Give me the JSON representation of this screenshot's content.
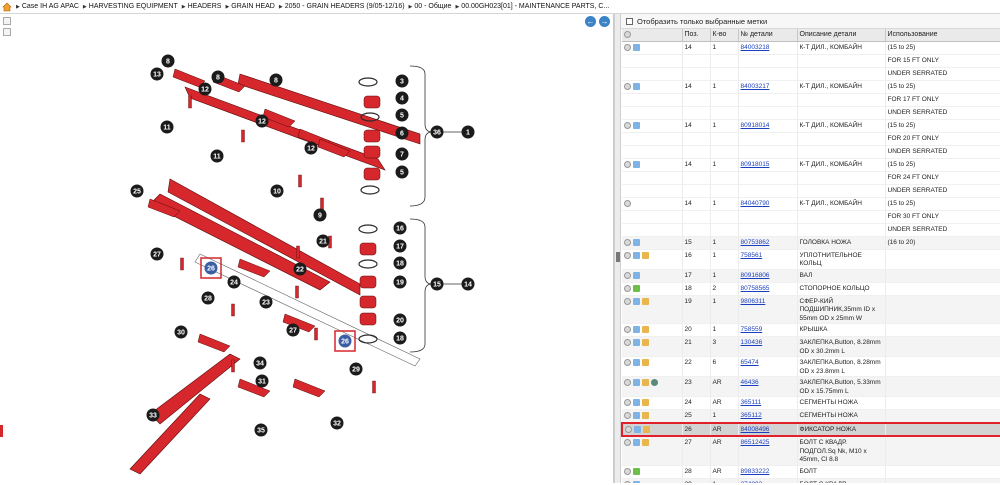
{
  "breadcrumb": [
    "Case IH AG APAC",
    "HARVESTING EQUIPMENT",
    "HEADERS",
    "GRAIN HEAD",
    "2050 - GRAIN HEADERS (9/05-12/16)",
    "00 - Общие",
    "00.00GH023[01] - MAINTENANCE PARTS, C..."
  ],
  "filter_label": "Отобразить только выбранные метки",
  "columns": [
    "Поз.",
    "К-во",
    "№ детали",
    "Описание детали",
    "Использование"
  ],
  "rows": [
    {
      "pos": "14",
      "qty": "1",
      "part": "84003218",
      "desc": "К-Т ДИЛ., КОМБАЙН",
      "use": [
        "(15 to 25)",
        "FOR 15 FT ONLY",
        "UNDER SERRATED"
      ],
      "icons": [
        "plus-icon",
        "swap-icon"
      ]
    },
    {
      "pos": "14",
      "qty": "1",
      "part": "84003217",
      "desc": "К-Т ДИЛ., КОМБАЙН",
      "use": [
        "(15 to 25)",
        "FOR 17 FT ONLY",
        "UNDER SERRATED"
      ],
      "icons": [
        "plus-icon",
        "swap-icon"
      ]
    },
    {
      "pos": "14",
      "qty": "1",
      "part": "80918014",
      "desc": "К-Т ДИЛ., КОМБАЙН",
      "use": [
        "(15 to 25)",
        "FOR 20 FT ONLY",
        "UNDER SERRATED"
      ],
      "icons": [
        "plus-icon",
        "swap-icon"
      ]
    },
    {
      "pos": "14",
      "qty": "1",
      "part": "80918015",
      "desc": "К-Т ДИЛ., КОМБАЙН",
      "use": [
        "(15 to 25)",
        "FOR 24 FT ONLY",
        "UNDER SERRATED"
      ],
      "icons": [
        "plus-icon",
        "swap-icon"
      ]
    },
    {
      "pos": "14",
      "qty": "1",
      "part": "84040790",
      "desc": "К-Т ДИЛ., КОМБАЙН",
      "use": [
        "(15 to 25)",
        "FOR 30 FT ONLY",
        "UNDER SERRATED"
      ],
      "icons": [
        "plus-icon"
      ]
    },
    {
      "pos": "15",
      "qty": "1",
      "part": "80753862",
      "desc": "ГОЛОВКА НОЖА",
      "use": [
        "(16 to 20)"
      ],
      "icons": [
        "plus-icon",
        "swap-icon"
      ]
    },
    {
      "pos": "16",
      "qty": "1",
      "part": "758561",
      "desc": "УПЛОТНИТЕЛЬНОЕ КОЛЬЦ",
      "use": [
        ""
      ],
      "icons": [
        "plus-icon",
        "swap-icon",
        "box-icon"
      ]
    },
    {
      "pos": "17",
      "qty": "1",
      "part": "80916806",
      "desc": "ВАЛ",
      "use": [
        ""
      ],
      "icons": [
        "plus-icon",
        "swap-icon"
      ]
    },
    {
      "pos": "18",
      "qty": "2",
      "part": "80758565",
      "desc": "СТОПОРНОЕ КОЛЬЦО",
      "use": [
        ""
      ],
      "icons": [
        "plus-icon",
        "arrow-icon"
      ]
    },
    {
      "pos": "19",
      "qty": "1",
      "part": "9806311",
      "desc": "СФЕР-КИЙ ПОДШИПНИК,35mm ID x 55mm OD x 25mm W",
      "use": [
        ""
      ],
      "icons": [
        "plus-icon",
        "swap-icon",
        "box-icon"
      ]
    },
    {
      "pos": "20",
      "qty": "1",
      "part": "758559",
      "desc": "КРЫШКА",
      "use": [
        ""
      ],
      "icons": [
        "plus-icon",
        "swap-icon",
        "box-icon"
      ]
    },
    {
      "pos": "21",
      "qty": "3",
      "part": "130436",
      "desc": "ЗАКЛЕПКА,Button, 8.28mm OD x 30.2mm L",
      "use": [
        ""
      ],
      "icons": [
        "plus-icon",
        "swap-icon",
        "box-icon"
      ]
    },
    {
      "pos": "22",
      "qty": "6",
      "part": "65474",
      "desc": "ЗАКЛЕПКА,Button, 8.28mm OD x 23.8mm L",
      "use": [
        ""
      ],
      "icons": [
        "plus-icon",
        "swap-icon",
        "box-icon"
      ]
    },
    {
      "pos": "23",
      "qty": "AR",
      "part": "46436",
      "desc": "ЗАКЛЕПКА,Button, 5.33mm OD x 15.75mm L",
      "use": [
        ""
      ],
      "icons": [
        "plus-icon",
        "swap-icon",
        "box-icon",
        "globe-icon"
      ]
    },
    {
      "pos": "24",
      "qty": "AR",
      "part": "365111",
      "desc": "СЕГМЕНТЫ НОЖА",
      "use": [
        ""
      ],
      "icons": [
        "plus-icon",
        "swap-icon",
        "box-icon"
      ]
    },
    {
      "pos": "25",
      "qty": "1",
      "part": "365112",
      "desc": "СЕГМЕНТЫ НОЖА",
      "use": [
        ""
      ],
      "icons": [
        "plus-icon",
        "swap-icon",
        "box-icon"
      ]
    },
    {
      "pos": "26",
      "qty": "AR",
      "part": "84008496",
      "desc": "ФИКСАТОР НОЖА",
      "use": [
        ""
      ],
      "icons": [
        "plus-icon",
        "swap-icon",
        "box-icon"
      ],
      "selected": true
    },
    {
      "pos": "27",
      "qty": "AR",
      "part": "86512425",
      "desc": "БОЛТ С КВАДР. ПОДГОЛ.Sq Nk, M10 x 45mm, Cl 8.8",
      "use": [
        ""
      ],
      "icons": [
        "plus-icon",
        "swap-icon",
        "box-icon"
      ]
    },
    {
      "pos": "28",
      "qty": "AR",
      "part": "89833222",
      "desc": "БОЛТ",
      "use": [
        ""
      ],
      "icons": [
        "plus-icon",
        "arrow-icon"
      ]
    },
    {
      "pos": "29",
      "qty": "1",
      "part": "374892",
      "desc": "БОЛТ С КВАДР. ПОДГОЛ.M10",
      "use": [
        ""
      ],
      "icons": [
        "plus-icon",
        "swap-icon"
      ]
    }
  ],
  "callouts": [
    "1",
    "3",
    "4",
    "5",
    "6",
    "7",
    "5",
    "8",
    "8",
    "8",
    "10",
    "11",
    "11",
    "12",
    "12",
    "12",
    "13",
    "14",
    "15",
    "16",
    "17",
    "18",
    "19",
    "20",
    "18",
    "21",
    "22",
    "23",
    "24",
    "25",
    "26",
    "26",
    "27",
    "27",
    "28",
    "29",
    "30",
    "31",
    "32",
    "33",
    "34",
    "35",
    "36",
    "9"
  ],
  "colors": {
    "accent_red": "#d6272c",
    "selection_border": "#e0202a",
    "link": "#1a3fbf",
    "callout": "#1b1b1b",
    "highlight_callout": "#3a5fa5"
  }
}
